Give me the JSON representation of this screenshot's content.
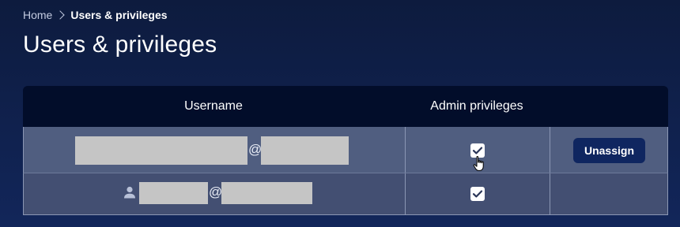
{
  "breadcrumb": {
    "home": "Home",
    "separator_icon": "chevron-right-icon",
    "current": "Users & privileges"
  },
  "page": {
    "title": "Users & privileges"
  },
  "table": {
    "columns": [
      "Username",
      "Admin privileges",
      ""
    ],
    "rows": [
      {
        "username_at": "@",
        "admin_checked": true,
        "action_label": "Unassign"
      },
      {
        "icon": "person-icon",
        "username_at": "@",
        "admin_checked": true,
        "action_label": ""
      }
    ]
  },
  "colors": {
    "background": "#0d1b3e",
    "header_bg": "#020d2a",
    "row_hover_bg": "#505e80",
    "row_bg": "#434f72",
    "button_bg": "#0f2660",
    "redaction": "#c5c5c5"
  }
}
